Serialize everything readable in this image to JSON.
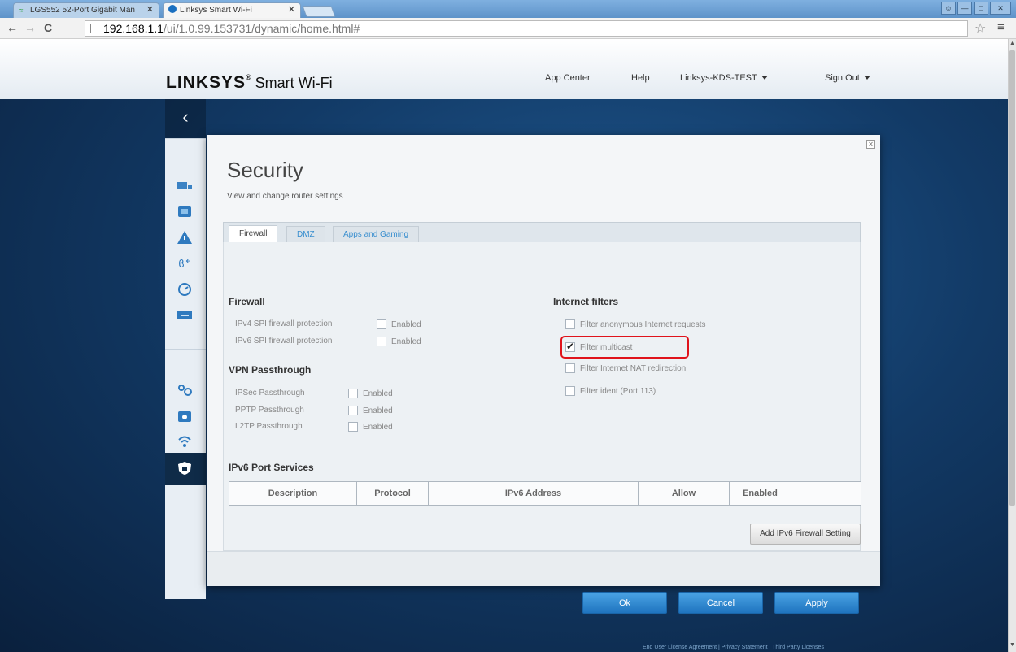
{
  "browser": {
    "tabs": [
      {
        "label": "LGS552 52-Port Gigabit Man"
      },
      {
        "label": "Linksys Smart Wi-Fi"
      }
    ],
    "url_host": "192.168.1.1",
    "url_path": "/ui/1.0.99.153731/dynamic/home.html#"
  },
  "header": {
    "logo": "LINKSYS",
    "logo_tm": "®",
    "logo_sub": "Smart Wi-Fi",
    "app_center": "App Center",
    "help": "Help",
    "network": "Linksys-KDS-TEST",
    "sign_out": "Sign Out"
  },
  "modal": {
    "title": "Security",
    "subtitle": "View and change router settings",
    "tabs": [
      "Firewall",
      "DMZ",
      "Apps and Gaming"
    ],
    "firewall": {
      "heading": "Firewall",
      "rows": [
        {
          "label": "IPv4 SPI firewall protection",
          "option": "Enabled"
        },
        {
          "label": "IPv6 SPI firewall protection",
          "option": "Enabled"
        }
      ]
    },
    "vpn": {
      "heading": "VPN Passthrough",
      "rows": [
        {
          "label": "IPSec Passthrough",
          "option": "Enabled"
        },
        {
          "label": "PPTP Passthrough",
          "option": "Enabled"
        },
        {
          "label": "L2TP Passthrough",
          "option": "Enabled"
        }
      ]
    },
    "filters": {
      "heading": "Internet filters",
      "items": [
        {
          "label": "Filter anonymous Internet requests",
          "checked": false
        },
        {
          "label": "Filter multicast",
          "checked": true
        },
        {
          "label": "Filter Internet NAT redirection",
          "checked": false
        },
        {
          "label": "Filter ident (Port 113)",
          "checked": false
        }
      ]
    },
    "ipv6": {
      "heading": "IPv6 Port Services",
      "columns": [
        "Description",
        "Protocol",
        "IPv6 Address",
        "Allow",
        "Enabled",
        ""
      ],
      "add_button": "Add IPv6 Firewall Setting"
    },
    "buttons": {
      "ok": "Ok",
      "cancel": "Cancel",
      "apply": "Apply"
    }
  },
  "footer_links": "End User License Agreement | Privacy Statement | Third Party Licenses"
}
